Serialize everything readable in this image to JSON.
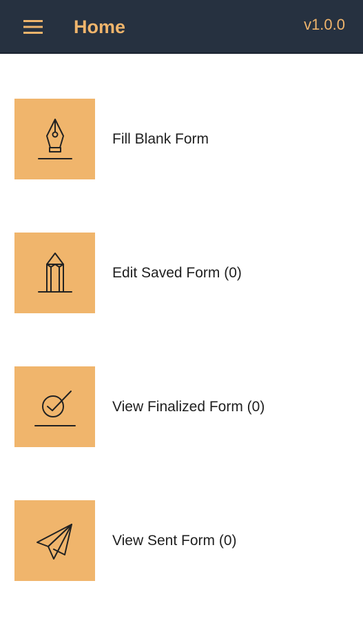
{
  "header": {
    "title": "Home",
    "version": "v1.0.0",
    "menu_icon": "hamburger-menu-icon"
  },
  "colors": {
    "appbar_bg": "#263140",
    "accent": "#f0b56c",
    "text": "#1f1f1f",
    "background": "#ffffff"
  },
  "menu": {
    "items": [
      {
        "label": "Fill Blank Form",
        "icon": "fountain-pen-icon"
      },
      {
        "label": "Edit Saved Form (0)",
        "icon": "pencil-icon"
      },
      {
        "label": "View Finalized Form (0)",
        "icon": "check-circle-icon"
      },
      {
        "label": "View Sent Form (0)",
        "icon": "paper-plane-icon"
      }
    ]
  }
}
